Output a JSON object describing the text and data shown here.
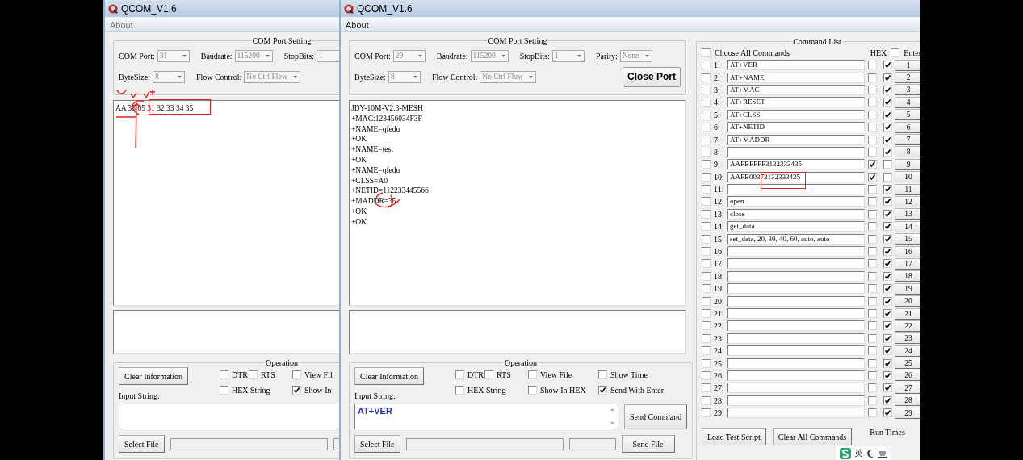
{
  "windows": [
    {
      "title": "QCOM_V1.6",
      "active": false,
      "menu": [
        {
          "label": "About"
        }
      ],
      "com_port_setting": {
        "title": "COM Port Setting",
        "rows": [
          [
            {
              "label": "COM Port:",
              "value": "31"
            },
            {
              "label": "Baudrate:",
              "value": "115200"
            },
            {
              "label": "StopBits:",
              "value": "1"
            }
          ],
          [
            {
              "label": "ByteSize:",
              "value": "8"
            },
            {
              "label": "Flow Control:",
              "value": "No Ctrl Flow"
            }
          ]
        ]
      },
      "receive_lines": [
        "AA 35 05 31 32 33 34 35"
      ],
      "operation": {
        "title": "Operation",
        "clear_button": "Clear Information",
        "checkbox_rows": [
          [
            {
              "label": "DTR",
              "checked": false
            },
            {
              "label": "RTS",
              "checked": false
            },
            {
              "label": "View Fil",
              "checked": false
            }
          ],
          [
            {
              "label": "HEX String",
              "checked": false
            },
            {
              "label": "Show In",
              "checked": true
            }
          ]
        ],
        "input_label": "Input String:",
        "select_file_button": "Select File"
      },
      "pen_marks": [
        {
          "kind": "box"
        },
        {
          "kind": "ticks"
        }
      ]
    },
    {
      "title": "QCOM_V1.6",
      "active": true,
      "menu": [
        {
          "label": "About"
        }
      ],
      "com_port_setting": {
        "title": "COM Port Setting",
        "rows": [
          [
            {
              "label": "COM Port:",
              "value": "29"
            },
            {
              "label": "Baudrate:",
              "value": "115200"
            },
            {
              "label": "StopBits:",
              "value": "1"
            },
            {
              "label": "Parity:",
              "value": "None"
            }
          ],
          [
            {
              "label": "ByteSize:",
              "value": "8"
            },
            {
              "label": "Flow Control:",
              "value": "No Ctrl Flow"
            }
          ]
        ],
        "button": "Close Port"
      },
      "receive_lines": [
        "JDY-10M-V2.3-MESH",
        "+MAC:123456034F3F",
        "+NAME=qfedu",
        "+OK",
        "+NAME=test",
        "+OK",
        "+NAME=qfedu",
        "+CLSS=A0",
        "+NETID=112233445566",
        "+MADDR=35",
        "+OK",
        "+OK"
      ],
      "operation": {
        "title": "Operation",
        "clear_button": "Clear Information",
        "checkbox_rows": [
          [
            {
              "label": "DTR",
              "checked": false
            },
            {
              "label": "RTS",
              "checked": false
            },
            {
              "label": "View File",
              "checked": false
            },
            {
              "label": "Show Time",
              "checked": false
            }
          ],
          [
            {
              "label": "HEX String",
              "checked": false
            },
            {
              "label": "Show In HEX",
              "checked": false
            },
            {
              "label": "Send With Enter",
              "checked": true
            }
          ]
        ],
        "input_label": "Input String:",
        "input_value": "AT+VER",
        "send_button": "Send Command",
        "select_file_button": "Select File",
        "send_file_button": "Send File"
      },
      "command_list": {
        "title": "Command List",
        "choose_all": {
          "label": "Choose All Commands",
          "checked": false
        },
        "hex_label": "HEX",
        "enter_all": {
          "label": "Enter",
          "checked": false
        },
        "rows": [
          {
            "number": "1:",
            "command": "AT+VER",
            "checked": false,
            "hex": false,
            "enter": true,
            "button": "1"
          },
          {
            "number": "2:",
            "command": "AT+NAME",
            "checked": false,
            "hex": false,
            "enter": true,
            "button": "2"
          },
          {
            "number": "3:",
            "command": "AT+MAC",
            "checked": false,
            "hex": false,
            "enter": true,
            "button": "3"
          },
          {
            "number": "4:",
            "command": "AT+RESET",
            "checked": false,
            "hex": false,
            "enter": true,
            "button": "4"
          },
          {
            "number": "5:",
            "command": "AT+CLSS",
            "checked": false,
            "hex": false,
            "enter": true,
            "button": "5"
          },
          {
            "number": "6:",
            "command": "AT+NETID",
            "checked": false,
            "hex": false,
            "enter": true,
            "button": "6"
          },
          {
            "number": "7:",
            "command": "AT+MADDR",
            "checked": false,
            "hex": false,
            "enter": true,
            "button": "7"
          },
          {
            "number": "8:",
            "checked": false,
            "hex": false,
            "enter": true,
            "button": "8"
          },
          {
            "number": "9:",
            "command": "AAFBFFFF3132333435",
            "checked": false,
            "hex": true,
            "enter": false,
            "button": "9"
          },
          {
            "number": "10:",
            "command": "AAFB00373132333435",
            "checked": false,
            "hex": true,
            "enter": false,
            "button": "10"
          },
          {
            "number": "11:",
            "checked": false,
            "hex": false,
            "enter": true,
            "button": "11"
          },
          {
            "number": "12:",
            "command": "open",
            "checked": false,
            "hex": false,
            "enter": true,
            "button": "12"
          },
          {
            "number": "13:",
            "command": "close",
            "checked": false,
            "hex": false,
            "enter": true,
            "button": "13"
          },
          {
            "number": "14:",
            "command": "get_data",
            "checked": false,
            "hex": false,
            "enter": true,
            "button": "14"
          },
          {
            "number": "15:",
            "command": "set_data, 20, 30, 40, 60, auto, auto",
            "checked": false,
            "hex": false,
            "enter": true,
            "button": "15"
          },
          {
            "number": "16:",
            "checked": false,
            "hex": false,
            "enter": true,
            "button": "16"
          },
          {
            "number": "17:",
            "checked": false,
            "hex": false,
            "enter": true,
            "button": "17"
          },
          {
            "number": "18:",
            "checked": false,
            "hex": false,
            "enter": true,
            "button": "18"
          },
          {
            "number": "19:",
            "checked": false,
            "hex": false,
            "enter": true,
            "button": "19"
          },
          {
            "number": "20:",
            "checked": false,
            "hex": false,
            "enter": true,
            "button": "20"
          },
          {
            "number": "21:",
            "checked": false,
            "hex": false,
            "enter": true,
            "button": "21"
          },
          {
            "number": "22:",
            "checked": false,
            "hex": false,
            "enter": true,
            "button": "22"
          },
          {
            "number": "23:",
            "checked": false,
            "hex": false,
            "enter": true,
            "button": "23"
          },
          {
            "number": "24:",
            "checked": false,
            "hex": false,
            "enter": true,
            "button": "24"
          },
          {
            "number": "25:",
            "checked": false,
            "hex": false,
            "enter": true,
            "button": "25"
          },
          {
            "number": "26:",
            "checked": false,
            "hex": false,
            "enter": true,
            "button": "26"
          },
          {
            "number": "27:",
            "checked": false,
            "hex": false,
            "enter": true,
            "button": "27"
          },
          {
            "number": "28:",
            "checked": false,
            "hex": false,
            "enter": true,
            "button": "28"
          },
          {
            "number": "29:",
            "checked": false,
            "hex": false,
            "enter": true,
            "button": "29"
          }
        ],
        "load_button": "Load Test Script",
        "clear_button": "Clear All Commands",
        "run_times_label": "Run Times"
      },
      "pen_marks": [
        {
          "kind": "circle"
        },
        {
          "kind": "box"
        }
      ]
    }
  ],
  "ime_bar": {
    "mode": "英"
  }
}
